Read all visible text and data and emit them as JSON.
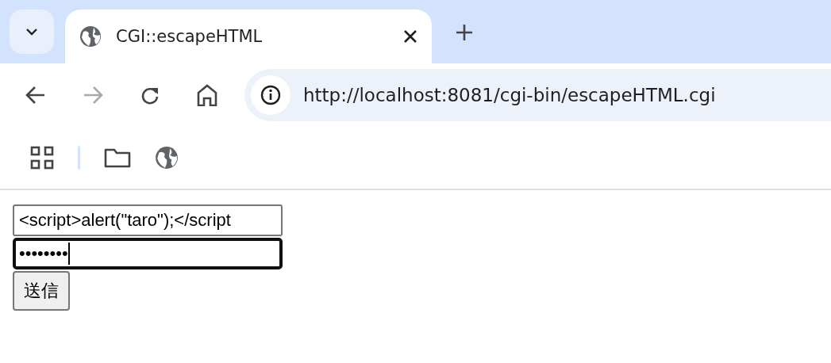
{
  "tabs": [
    {
      "title": "CGI::escapeHTML",
      "selected": true
    }
  ],
  "toolbar": {
    "back_disabled": false,
    "forward_disabled": true
  },
  "address_bar": {
    "url": "http://localhost:8081/cgi-bin/escapeHTML.cgi"
  },
  "form": {
    "text_field": {
      "value": "<script>alert(\"taro\");</script",
      "focused": false
    },
    "password_field": {
      "value": "••••••••",
      "focused": true
    },
    "submit_button": "送信"
  }
}
